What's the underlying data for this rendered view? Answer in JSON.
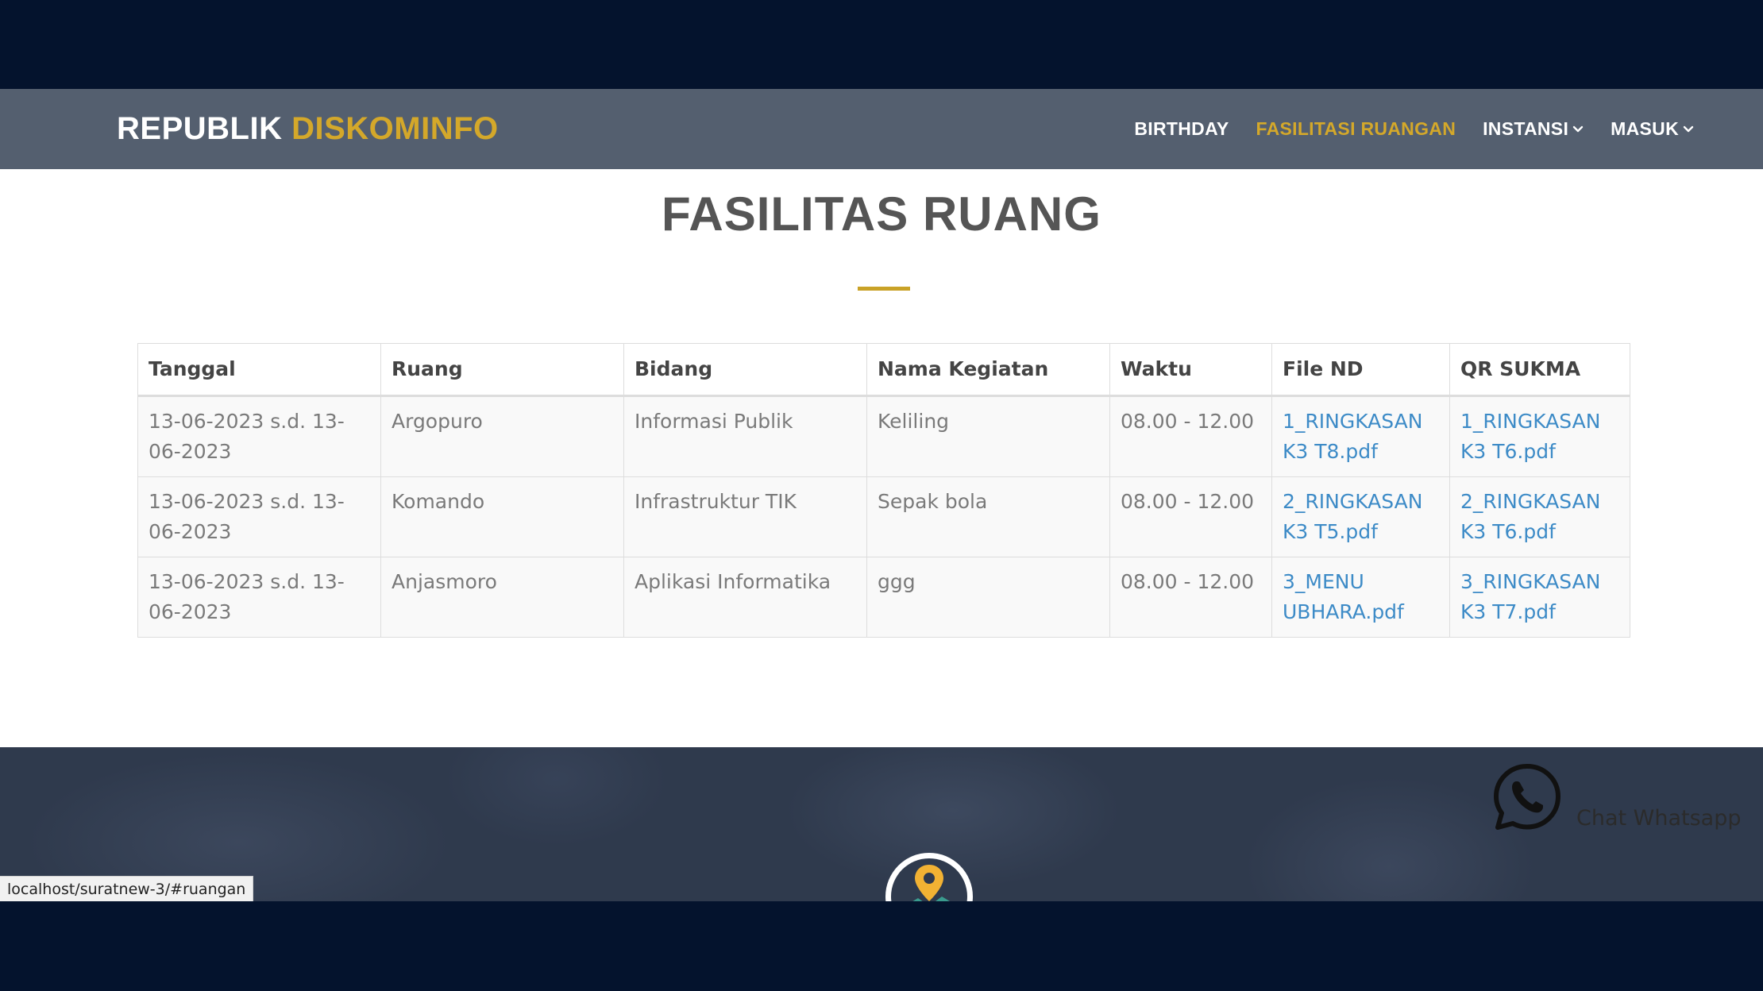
{
  "brand": {
    "main": "REPUBLIK ",
    "accent": "DISKOMINFO"
  },
  "nav": {
    "birthday": "BIRTHDAY",
    "fasilitas": "FASILITASI RUANGAN",
    "instansi": "INSTANSI",
    "masuk": "MASUK"
  },
  "page": {
    "title": "FASILITAS RUANG"
  },
  "table": {
    "headers": [
      "Tanggal",
      "Ruang",
      "Bidang",
      "Nama Kegiatan",
      "Waktu",
      "File ND",
      "QR SUKMA"
    ],
    "rows": [
      {
        "tanggal": "13-06-2023 s.d. 13-06-2023",
        "ruang": "Argopuro",
        "bidang": "Informasi Publik",
        "kegiatan": "Keliling",
        "waktu": "08.00 - 12.00",
        "file_nd": "1_RINGKASAN K3 T8.pdf",
        "qr_sukma": "1_RINGKASAN K3 T6.pdf"
      },
      {
        "tanggal": "13-06-2023 s.d. 13-06-2023",
        "ruang": "Komando",
        "bidang": "Infrastruktur TIK",
        "kegiatan": "Sepak bola",
        "waktu": "08.00 - 12.00",
        "file_nd": "2_RINGKASAN K3 T5.pdf",
        "qr_sukma": "2_RINGKASAN K3 T6.pdf"
      },
      {
        "tanggal": "13-06-2023 s.d. 13-06-2023",
        "ruang": "Anjasmoro",
        "bidang": "Aplikasi Informatika",
        "kegiatan": "ggg",
        "waktu": "08.00 - 12.00",
        "file_nd": "3_MENU UBHARA.pdf",
        "qr_sukma": "3_RINGKASAN K3 T7.pdf"
      }
    ]
  },
  "footer": {
    "whatsapp_label": "Chat Whatsapp",
    "whatsapp_icon": "whatsapp-icon",
    "map_icon": "map-pin-icon"
  },
  "status": {
    "url": "localhost/suratnew-3/#ruangan"
  },
  "colors": {
    "accent": "#d4a82a",
    "navbar": "#545f6f",
    "link": "#3d8bc7",
    "backdrop": "#04132d"
  }
}
